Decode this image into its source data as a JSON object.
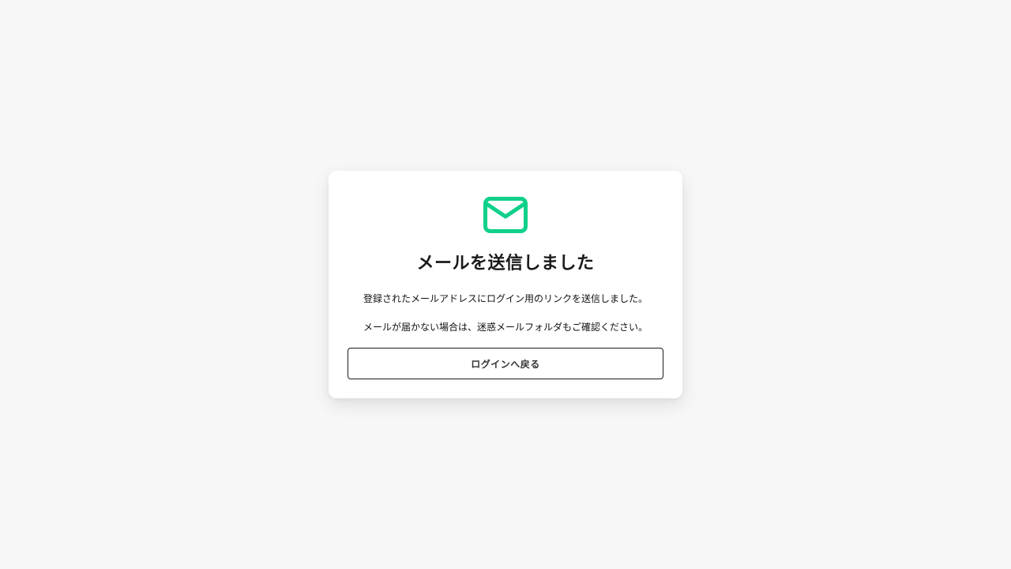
{
  "card": {
    "icon": "mail-icon",
    "accent_color": "#10d08a",
    "title": "メールを送信しました",
    "message_1": "登録されたメールアドレスにログイン用のリンクを送信しました。",
    "message_2": "メールが届かない場合は、迷惑メールフォルダもご確認ください。",
    "back_button_label": "ログインへ戻る"
  }
}
